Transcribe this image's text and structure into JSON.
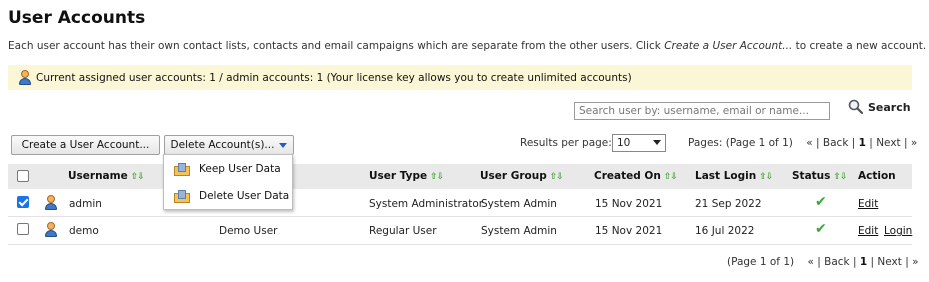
{
  "header": {
    "title": "User Accounts",
    "description_prefix": "Each user account has their own contact lists, contacts and email campaigns which are separate from the other users. Click ",
    "description_link": "Create a User Account...",
    "description_suffix": " to create a new account."
  },
  "notice": {
    "text": "Current assigned user accounts: 1 / admin accounts: 1 (Your license key allows you to create unlimited accounts)"
  },
  "search": {
    "placeholder": "Search user by: username, email or name...",
    "button_label": "Search"
  },
  "toolbar": {
    "create_label": "Create a User Account...",
    "delete_label": "Delete Account(s)...",
    "results_per_page_label": "Results per page:",
    "results_per_page_value": "10",
    "pages_text": "Pages: (Page 1 of 1)",
    "nav_first": "«",
    "nav_back": "Back",
    "nav_current": "1",
    "nav_next": "Next",
    "nav_last": "»",
    "sep": "|"
  },
  "delete_menu": {
    "items": [
      {
        "label": "Keep User Data"
      },
      {
        "label": "Delete User Data"
      }
    ]
  },
  "table": {
    "columns": {
      "username": "Username",
      "user_type": "User Type",
      "user_group": "User Group",
      "created_on": "Created On",
      "last_login": "Last Login",
      "status": "Status",
      "action": "Action"
    },
    "sort_arrows": "⇧⇩",
    "rows": [
      {
        "checked": true,
        "username": "admin",
        "name": "",
        "user_type": "System Administrator",
        "user_group": "System Admin",
        "created_on": "15 Nov 2021",
        "last_login": "21 Sep 2022",
        "status": "active",
        "actions": [
          "Edit"
        ]
      },
      {
        "checked": false,
        "username": "demo",
        "name": "Demo User",
        "user_type": "Regular User",
        "user_group": "System Admin",
        "created_on": "15 Nov 2021",
        "last_login": "16 Jul 2022",
        "status": "active",
        "actions": [
          "Edit",
          "Login"
        ]
      }
    ]
  },
  "footer": {
    "pages_text": "(Page 1 of 1)"
  },
  "colors": {
    "notice_bg": "#fbf7d6",
    "header_bg": "#e9e9e9",
    "accent": "#1f5fbf",
    "status_ok": "#3aa63a"
  },
  "icons": [
    "user-icon",
    "search-icon",
    "folder-icon",
    "check-icon",
    "sort-arrows-icon",
    "caret-down-icon"
  ]
}
